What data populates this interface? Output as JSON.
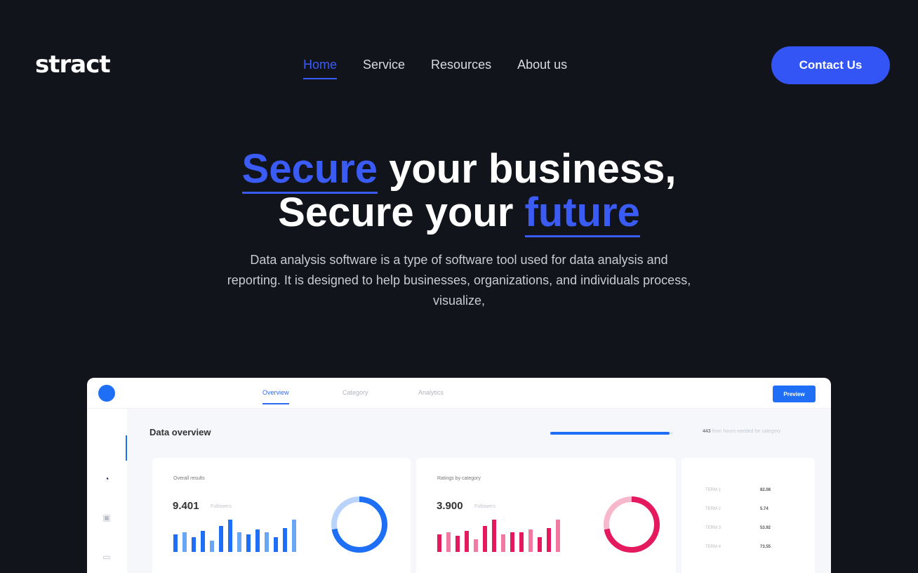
{
  "header": {
    "logo": "stract",
    "nav": [
      "Home",
      "Service",
      "Resources",
      "About us"
    ],
    "cta": "Contact Us"
  },
  "hero": {
    "line1_highlight": "Secure",
    "line1_rest": " your business,",
    "line2_start": "Secure your ",
    "line2_highlight": "future",
    "description": "Data analysis software is a type of software tool used for data analysis and reporting. It is designed to help businesses, organizations, and individuals process, visualize,"
  },
  "dashboard": {
    "tabs": [
      "Overview",
      "Category",
      "Analytics"
    ],
    "button": "Preview",
    "title": "Data overview",
    "progress": {
      "fraction": 0.97,
      "label_value": "443",
      "label_text": "from hours needed for category"
    },
    "cards": [
      {
        "title": "Overall results",
        "number": "9.401",
        "sub": "Followers",
        "color": "#1e6ff5",
        "bars": [
          0.55,
          0.6,
          0.45,
          0.65,
          0.35,
          0.8,
          1.0,
          0.6,
          0.55,
          0.7,
          0.6,
          0.45,
          0.75,
          1.0
        ],
        "donut_fraction": 0.72
      },
      {
        "title": "Ratings by category",
        "number": "3.900",
        "sub": "Followers",
        "color": "#e5195e",
        "bars": [
          0.55,
          0.6,
          0.5,
          0.65,
          0.4,
          0.8,
          1.0,
          0.55,
          0.6,
          0.6,
          0.7,
          0.45,
          0.75,
          1.0
        ],
        "donut_fraction": 0.72
      }
    ],
    "stats": [
      {
        "key": "TERM 1",
        "value": "82.08"
      },
      {
        "key": "TERM 2",
        "value": "5.74"
      },
      {
        "key": "TERM 3",
        "value": "53.92"
      },
      {
        "key": "TERM 4",
        "value": "73.55"
      }
    ],
    "sidebar_icons": [
      "dashboard-icon",
      "chat-icon",
      "folder-icon",
      "mail-icon"
    ]
  }
}
